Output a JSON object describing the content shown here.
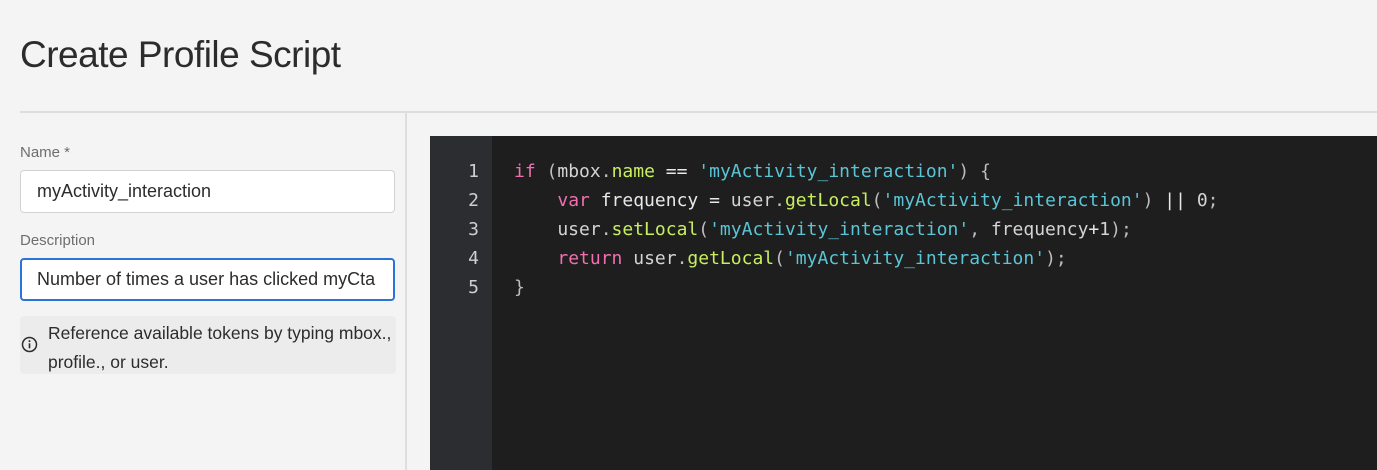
{
  "header": {
    "title": "Create Profile Script"
  },
  "form": {
    "name_label": "Name *",
    "name_value": "myActivity_interaction",
    "description_label": "Description",
    "description_value": "Number of times a user has clicked myCta",
    "info_text": "Reference available tokens by typing mbox., profile., or user.",
    "info_icon": "info-icon"
  },
  "editor": {
    "line_numbers": [
      "1",
      "2",
      "3",
      "4",
      "5"
    ],
    "lines": [
      {
        "tokens": [
          {
            "t": "keyword",
            "v": "if"
          },
          {
            "t": "punct",
            "v": " ("
          },
          {
            "t": "plain",
            "v": "mbox"
          },
          {
            "t": "punct",
            "v": "."
          },
          {
            "t": "prop",
            "v": "name"
          },
          {
            "t": "ident",
            "v": " == "
          },
          {
            "t": "string",
            "v": "'myActivity_interaction'"
          },
          {
            "t": "punct",
            "v": ") {"
          }
        ]
      },
      {
        "tokens": [
          {
            "t": "plain",
            "v": "    "
          },
          {
            "t": "keyword",
            "v": "var"
          },
          {
            "t": "ident",
            "v": " frequency = "
          },
          {
            "t": "plain",
            "v": "user"
          },
          {
            "t": "punct",
            "v": "."
          },
          {
            "t": "prop",
            "v": "getLocal"
          },
          {
            "t": "punct",
            "v": "("
          },
          {
            "t": "string",
            "v": "'myActivity_interaction'"
          },
          {
            "t": "punct",
            "v": ")"
          },
          {
            "t": "ident",
            "v": " || "
          },
          {
            "t": "number",
            "v": "0"
          },
          {
            "t": "punct",
            "v": ";"
          }
        ]
      },
      {
        "tokens": [
          {
            "t": "plain",
            "v": "    user"
          },
          {
            "t": "punct",
            "v": "."
          },
          {
            "t": "prop",
            "v": "setLocal"
          },
          {
            "t": "punct",
            "v": "("
          },
          {
            "t": "string",
            "v": "'myActivity_interaction'"
          },
          {
            "t": "punct",
            "v": ", "
          },
          {
            "t": "plain",
            "v": "frequency"
          },
          {
            "t": "ident",
            "v": "+"
          },
          {
            "t": "number",
            "v": "1"
          },
          {
            "t": "punct",
            "v": ");"
          }
        ]
      },
      {
        "tokens": [
          {
            "t": "plain",
            "v": "    "
          },
          {
            "t": "keyword",
            "v": "return"
          },
          {
            "t": "plain",
            "v": " user"
          },
          {
            "t": "punct",
            "v": "."
          },
          {
            "t": "prop",
            "v": "getLocal"
          },
          {
            "t": "punct",
            "v": "("
          },
          {
            "t": "string",
            "v": "'myActivity_interaction'"
          },
          {
            "t": "punct",
            "v": ");"
          }
        ]
      },
      {
        "tokens": [
          {
            "t": "punct",
            "v": "}"
          }
        ]
      }
    ]
  },
  "colors": {
    "background": "#f4f4f4",
    "focus_border": "#2b73d9",
    "editor_background": "#1e1e1e",
    "gutter_background": "#2b2d30",
    "keyword": "#f06fb1",
    "property": "#c7ef5e",
    "string": "#59c5d6"
  }
}
